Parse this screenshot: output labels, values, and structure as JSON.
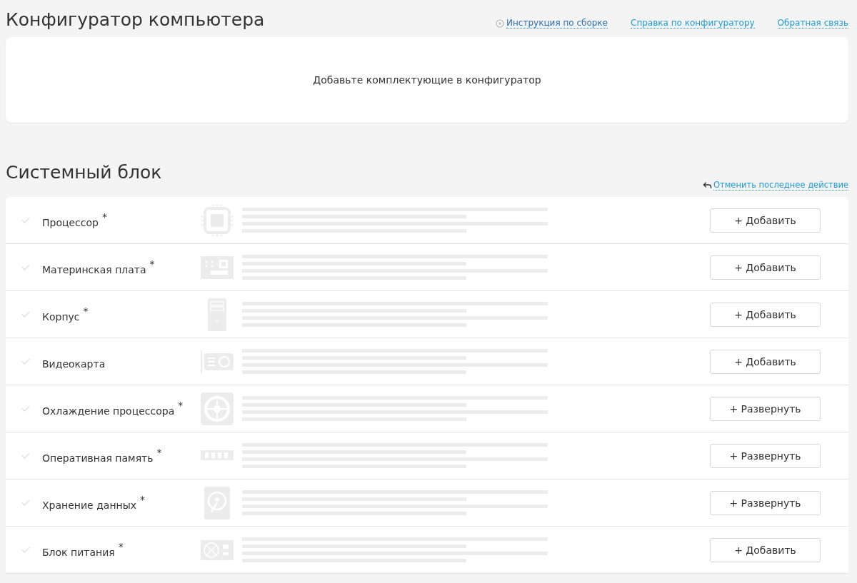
{
  "page_title": "Конфигуратор компьютера",
  "header_links": [
    {
      "label": "Инструкция по сборке",
      "kind": "video"
    },
    {
      "label": "Справка по конфигуратору",
      "kind": "plain"
    },
    {
      "label": "Обратная связь",
      "kind": "plain"
    }
  ],
  "summary": {
    "message": "Добавьте комплектующие в конфигуратор"
  },
  "section": {
    "title": "Системный блок",
    "undo_link": "Отменить последнее действие"
  },
  "components": [
    {
      "name": "Процессор",
      "required_mark": "*",
      "kind": "cpu",
      "checked": false,
      "button": "+ Добавить"
    },
    {
      "name": "Материнская плата",
      "required_mark": "*",
      "kind": "board",
      "checked": false,
      "button": "+ Добавить"
    },
    {
      "name": "Корпус",
      "required_mark": "*",
      "kind": "case",
      "checked": false,
      "button": "+ Добавить"
    },
    {
      "name": "Видеокарта",
      "kind": "gpu",
      "checked": false,
      "button": "+ Добавить"
    },
    {
      "name": "Охлаждение процессора",
      "required_mark": "*",
      "kind": "fan",
      "checked": false,
      "button": "+ Развернуть"
    },
    {
      "name": "Оперативная память",
      "required_mark": "*",
      "kind": "ram",
      "checked": false,
      "button": "+ Развернуть"
    },
    {
      "name": "Хранение данных",
      "required_mark": "*",
      "kind": "hdd",
      "checked": false,
      "button": "+ Развернуть"
    },
    {
      "name": "Блок питания",
      "required_mark": "*",
      "kind": "psu",
      "checked": false,
      "button": "+ Добавить"
    }
  ]
}
